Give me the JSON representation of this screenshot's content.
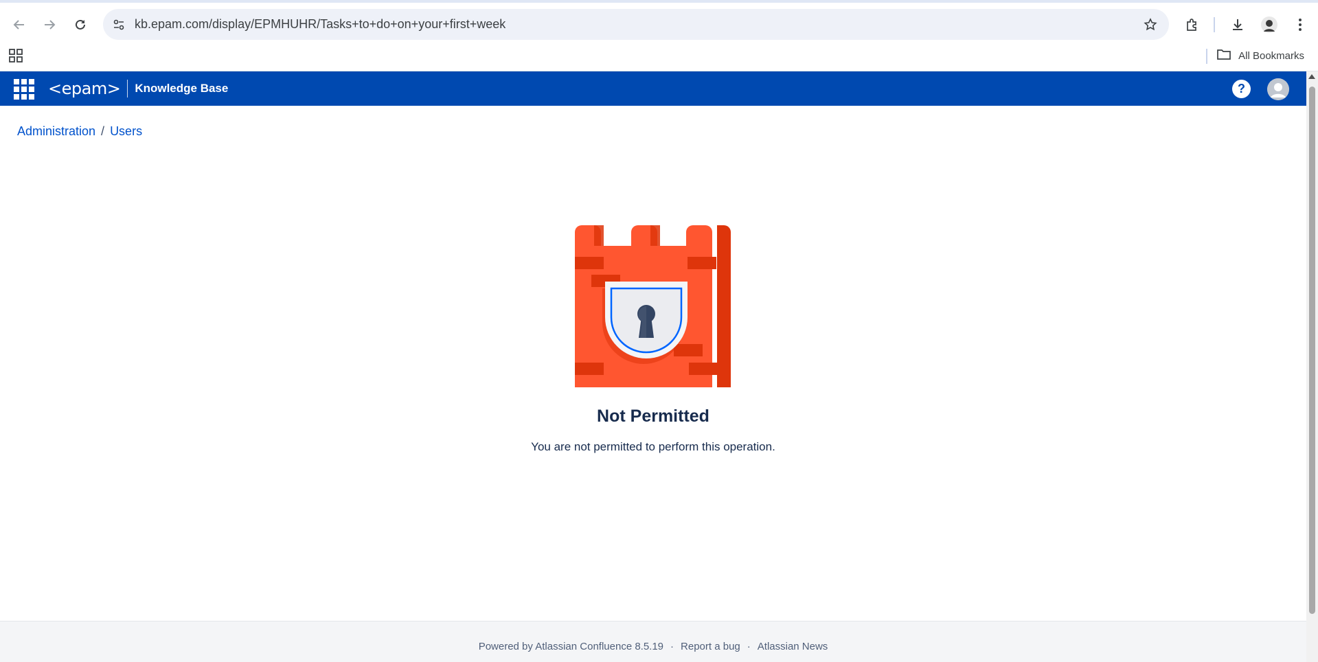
{
  "browser": {
    "url": "kb.epam.com/display/EPMHUHR/Tasks+to+do+on+your+first+week",
    "bookmarks_label": "All Bookmarks",
    "icons": [
      "back-arrow-icon",
      "forward-arrow-icon",
      "reload-icon",
      "site-settings-icon",
      "star-icon",
      "extensions-icon",
      "download-icon",
      "profile-avatar",
      "kebab-menu-icon",
      "apps-grid-icon",
      "folder-icon"
    ]
  },
  "app_header": {
    "brand": "<epam>",
    "product": "Knowledge Base",
    "help_glyph": "?",
    "color": "#0049b0"
  },
  "breadcrumb": {
    "items": [
      {
        "label": "Administration"
      },
      {
        "label": "Users"
      }
    ],
    "separator": "/"
  },
  "main": {
    "title": "Not Permitted",
    "message": "You are not permitted to perform this operation.",
    "illustration": "locked-castle-tower"
  },
  "footer": {
    "links": [
      {
        "label": "Powered by Atlassian Confluence 8.5.19"
      },
      {
        "label": "Report a bug"
      },
      {
        "label": "Atlassian News"
      }
    ],
    "separator": "·"
  },
  "colors": {
    "link": "#0052cc",
    "heading": "#172b4d",
    "tower": "#ff5630",
    "tower_shade": "#de350b"
  }
}
